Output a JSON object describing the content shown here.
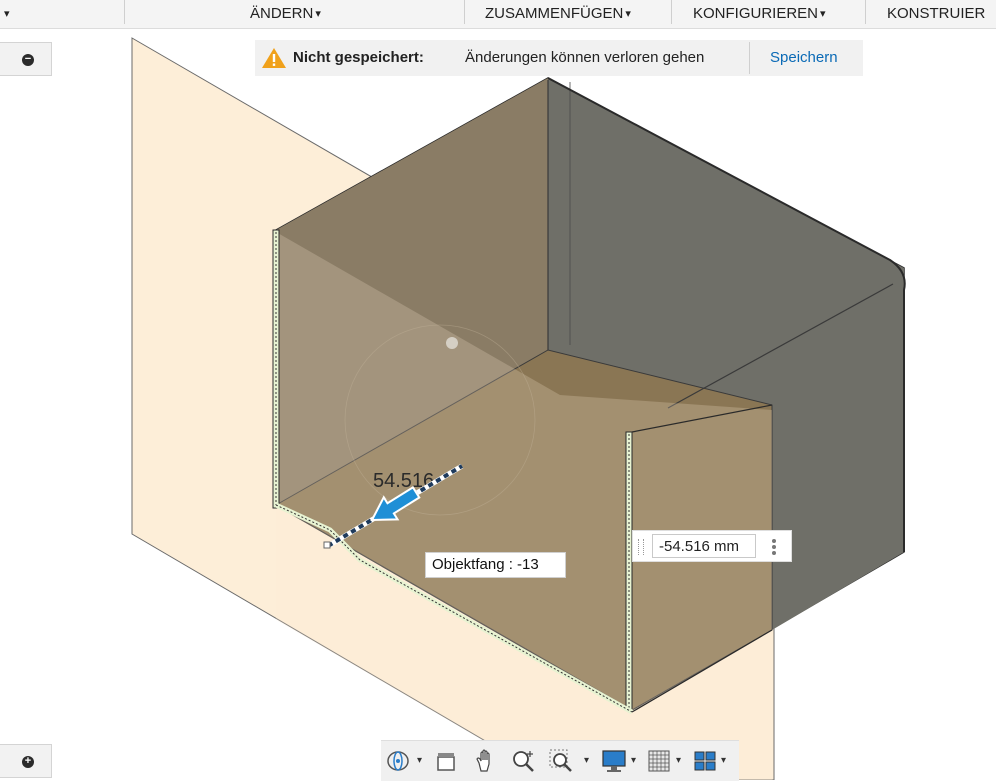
{
  "toolbar": {
    "items": [
      {
        "label": "ÄNDERN"
      },
      {
        "label": "ZUSAMMENFÜGEN"
      },
      {
        "label": "KONFIGURIEREN"
      },
      {
        "label": "KONSTRUIER"
      }
    ],
    "caret": "▾"
  },
  "banner": {
    "title": "Nicht gespeichert:",
    "message": "Änderungen können verloren gehen",
    "action": "Speichern",
    "warning_color": "#f0a11b"
  },
  "canvas": {
    "dimension_label": "54.516",
    "snap_tooltip": "Objektfang : -13"
  },
  "dimension_input": {
    "value": "-54.516 mm"
  },
  "side_buttons": {
    "top_glyph": "−",
    "bottom_glyph": "+"
  },
  "colors": {
    "accent": "#0a6ab6",
    "plane_fill": "#fdeed8",
    "arrow": "#1f8fd6",
    "part_fill": "#6b5c45"
  },
  "navbar": {
    "tools": [
      "orbit-icon",
      "look-at-icon",
      "pan-icon",
      "zoom-icon",
      "zoom-window-icon",
      "display-icon",
      "grid-icon",
      "viewports-icon"
    ]
  }
}
